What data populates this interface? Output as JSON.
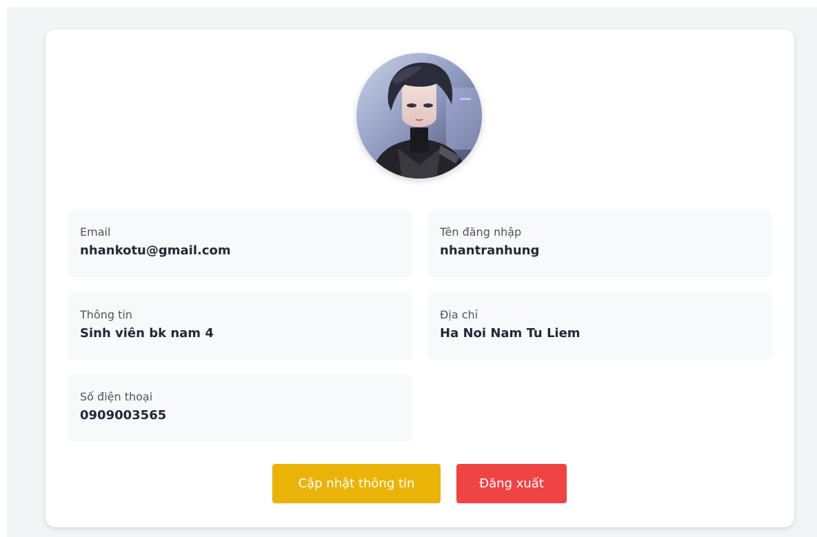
{
  "profile": {
    "fields": [
      {
        "label": "Email",
        "value": "nhankotu@gmail.com"
      },
      {
        "label": "Tên đăng nhập",
        "value": "nhantranhung"
      },
      {
        "label": "Thông tin",
        "value": "Sinh viên bk nam 4"
      },
      {
        "label": "Địa chỉ",
        "value": "Ha Noi Nam Tu Liem"
      },
      {
        "label": "Số điện thoại",
        "value": "0909003565"
      }
    ]
  },
  "actions": {
    "update_label": "Cập nhật thông tin",
    "logout_label": "Đăng xuất"
  },
  "colors": {
    "update_button": "#eab308",
    "logout_button": "#ef4444",
    "page_background": "#f3f4f6",
    "field_background": "#f8f9fb"
  }
}
